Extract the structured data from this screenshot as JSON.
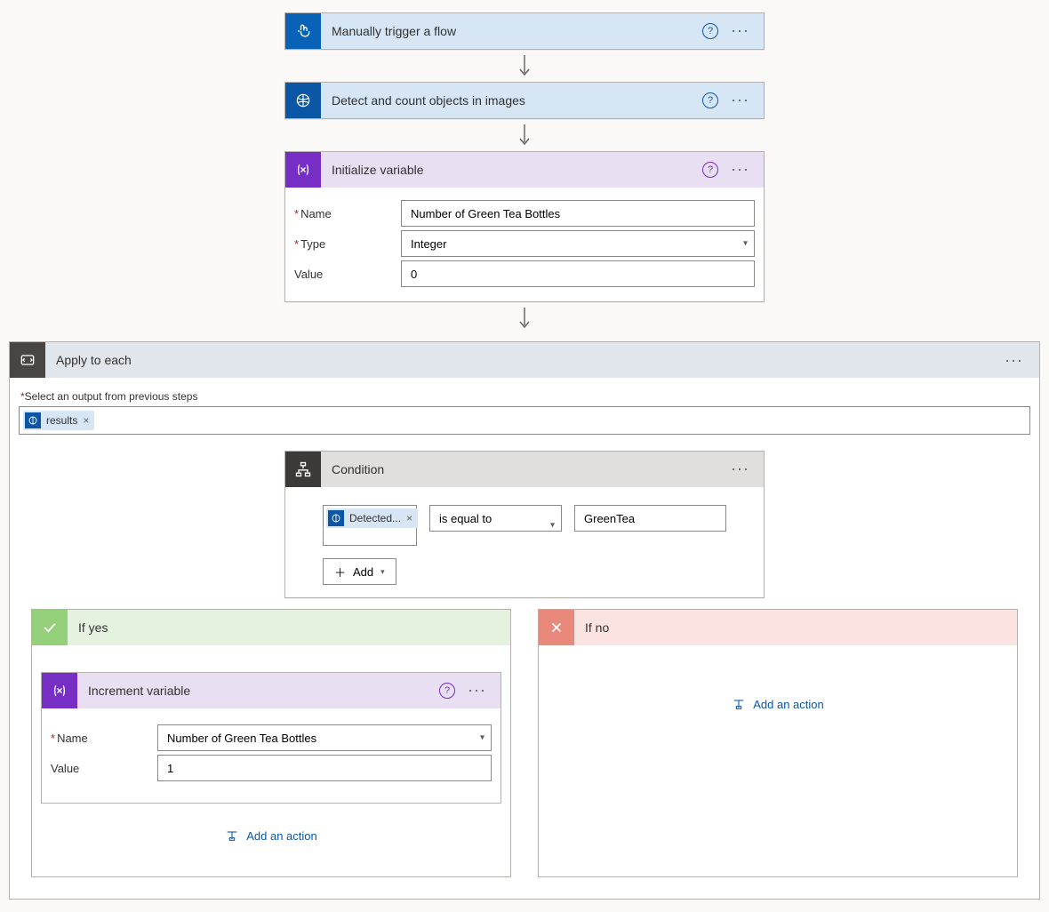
{
  "steps": {
    "trigger": {
      "title": "Manually trigger a flow"
    },
    "detect": {
      "title": "Detect and count objects in images"
    },
    "initvar": {
      "title": "Initialize variable",
      "name_label": "Name",
      "name_value": "Number of Green Tea Bottles",
      "type_label": "Type",
      "type_value": "Integer",
      "value_label": "Value",
      "value_value": "0"
    },
    "apply": {
      "title": "Apply to each",
      "select_label": "Select an output from previous steps",
      "token": "results"
    },
    "condition": {
      "title": "Condition",
      "left_token": "Detected...",
      "operator": "is equal to",
      "value": "GreenTea",
      "add_label": "Add"
    },
    "if_yes": {
      "title": "If yes"
    },
    "if_no": {
      "title": "If no"
    },
    "incvar": {
      "title": "Increment variable",
      "name_label": "Name",
      "name_value": "Number of Green Tea Bottles",
      "value_label": "Value",
      "value_value": "1"
    },
    "add_action": "Add an action",
    "req_prefix": "*"
  }
}
